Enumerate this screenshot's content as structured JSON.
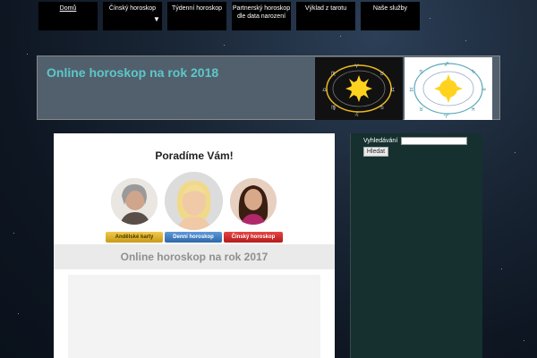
{
  "nav": {
    "items": [
      {
        "label": "Domů"
      },
      {
        "label": "Čínský horoskop",
        "has_submenu": true
      },
      {
        "label": "Týdenní horoskop"
      },
      {
        "label": "Partnerský horoskop dle data narození"
      },
      {
        "label": "Výklad z tarotu"
      },
      {
        "label": "Naše služby"
      }
    ]
  },
  "banner": {
    "title": "Online horoskop na rok 2018",
    "title_color": "#5cc8c8"
  },
  "main": {
    "heading": "Poradíme Vám!",
    "buttons": [
      {
        "label": "Andělské karty",
        "color": "#f2c94c"
      },
      {
        "label": "Denní horoskop",
        "color": "#2d67a8"
      },
      {
        "label": "Čínský horoskop",
        "color": "#c81d1d"
      }
    ],
    "subheading": "Online horoskop na rok 2017"
  },
  "sidebar": {
    "search_label": "Vyhledávání",
    "search_button": "Hledat"
  }
}
